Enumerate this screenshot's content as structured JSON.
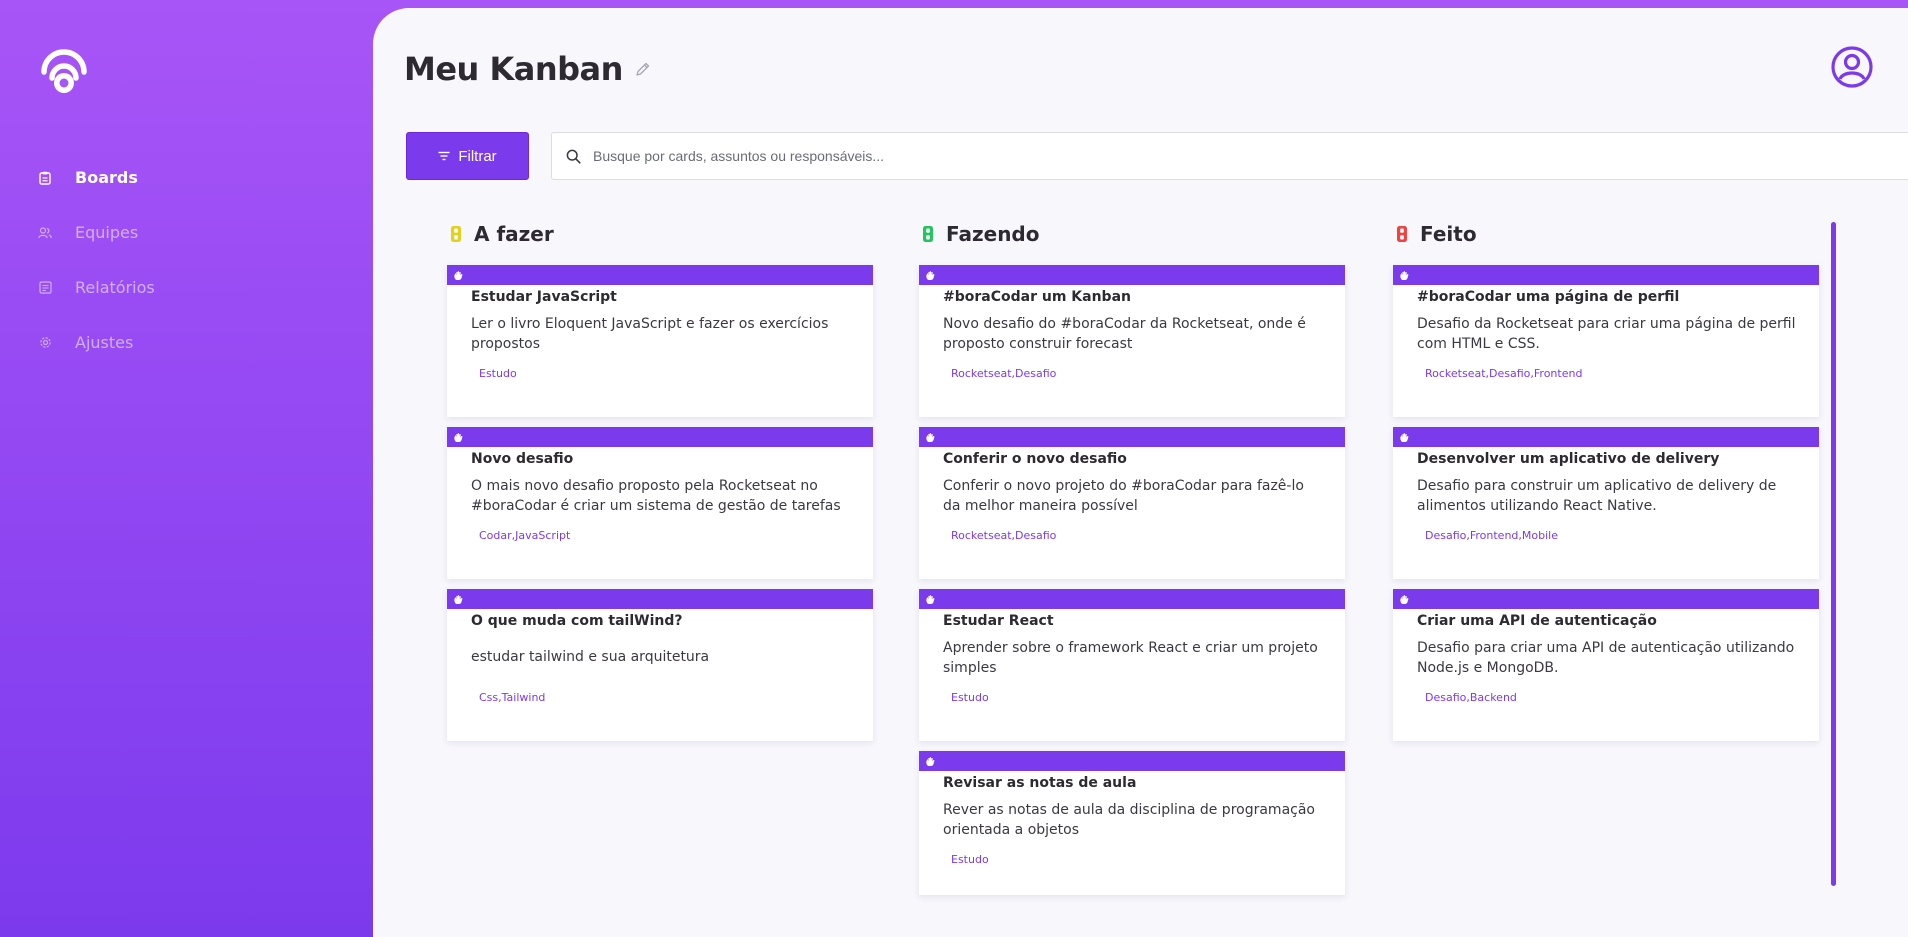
{
  "sidebar": {
    "items": [
      {
        "label": "Boards",
        "icon": "clipboard-icon"
      },
      {
        "label": "Equipes",
        "icon": "users-icon"
      },
      {
        "label": "Relatórios",
        "icon": "report-icon"
      },
      {
        "label": "Ajustes",
        "icon": "gear-icon"
      }
    ],
    "active": "Boards"
  },
  "header": {
    "title": "Meu Kanban"
  },
  "toolbar": {
    "filter_label": "Filtrar",
    "search_placeholder": "Busque por cards, assuntos ou responsáveis..."
  },
  "colors": {
    "accent": "#7c3aed",
    "todo_icon": "#e3d21b",
    "doing_icon": "#22c55e",
    "done_icon": "#ef4444"
  },
  "columns": [
    {
      "title": "A fazer",
      "cards": [
        {
          "title": "Estudar JavaScript",
          "description": "Ler o livro Eloquent JavaScript e fazer os exercícios propostos",
          "tags": "Estudo"
        },
        {
          "title": "Novo desafio",
          "description": "O mais novo desafio proposto pela Rocketseat no #boraCodar é criar um sistema de gestão de tarefas",
          "tags": "Codar,JavaScript"
        },
        {
          "title": "O que muda com tailWind?",
          "description": "estudar tailwind e sua arquitetura",
          "tags": "Css,Tailwind"
        }
      ]
    },
    {
      "title": "Fazendo",
      "cards": [
        {
          "title": "#boraCodar um Kanban",
          "description": "Novo desafio do #boraCodar da Rocketseat, onde é proposto construir forecast",
          "tags": "Rocketseat,Desafio"
        },
        {
          "title": "Conferir o novo desafio",
          "description": "Conferir o novo projeto do #boraCodar para fazê-lo da melhor maneira possível",
          "tags": "Rocketseat,Desafio"
        },
        {
          "title": "Estudar React",
          "description": "Aprender sobre o framework React e criar um projeto simples",
          "tags": "Estudo"
        },
        {
          "title": "Revisar as notas de aula",
          "description": "Rever as notas de aula da disciplina de programação orientada a objetos",
          "tags": "Estudo"
        }
      ]
    },
    {
      "title": "Feito",
      "cards": [
        {
          "title": "#boraCodar uma página de perfil",
          "description": "Desafio da Rocketseat para criar uma página de perfil com HTML e CSS.",
          "tags": "Rocketseat,Desafio,Frontend"
        },
        {
          "title": "Desenvolver um aplicativo de delivery",
          "description": "Desafio para construir um aplicativo de delivery de alimentos utilizando React Native.",
          "tags": "Desafio,Frontend,Mobile"
        },
        {
          "title": "Criar uma API de autenticação",
          "description": "Desafio para criar uma API de autenticação utilizando Node.js e MongoDB.",
          "tags": "Desafio,Backend"
        }
      ]
    }
  ]
}
